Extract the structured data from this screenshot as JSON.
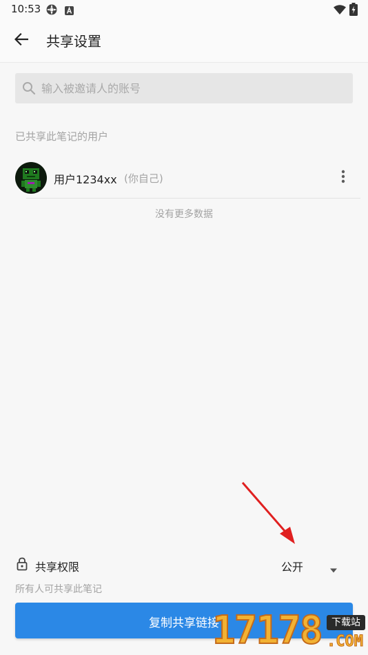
{
  "status_bar": {
    "time": "10:53",
    "icons": [
      "settings-gear-icon",
      "a-badge-icon",
      "wifi-icon",
      "battery-charging-icon"
    ]
  },
  "header": {
    "back_icon": "arrow-left-icon",
    "title": "共享设置"
  },
  "search": {
    "icon": "search-icon",
    "placeholder": "输入被邀请人的账号",
    "value": ""
  },
  "shared_users": {
    "section_title": "已共享此笔记的用户",
    "users": [
      {
        "avatar": "pixel-robot-avatar",
        "name": "用户1234xx",
        "note": "(你自己)",
        "menu_icon": "more-vertical-icon"
      }
    ],
    "empty_hint": "没有更多数据"
  },
  "permission": {
    "icon": "lock-icon",
    "label": "共享权限",
    "selected": "公开",
    "dropdown_icon": "caret-down-icon",
    "description": "所有人可共享此笔记"
  },
  "actions": {
    "copy_link_label": "复制共享链接"
  },
  "overlay": {
    "annotation_arrow_color": "#e02020"
  },
  "watermark": {
    "digits": "17178",
    "badge": "下载站",
    "sub": ".COM"
  },
  "colors": {
    "accent": "#2b88e6",
    "background": "#f7f7f7",
    "secondary_text": "#a3a3a3"
  }
}
